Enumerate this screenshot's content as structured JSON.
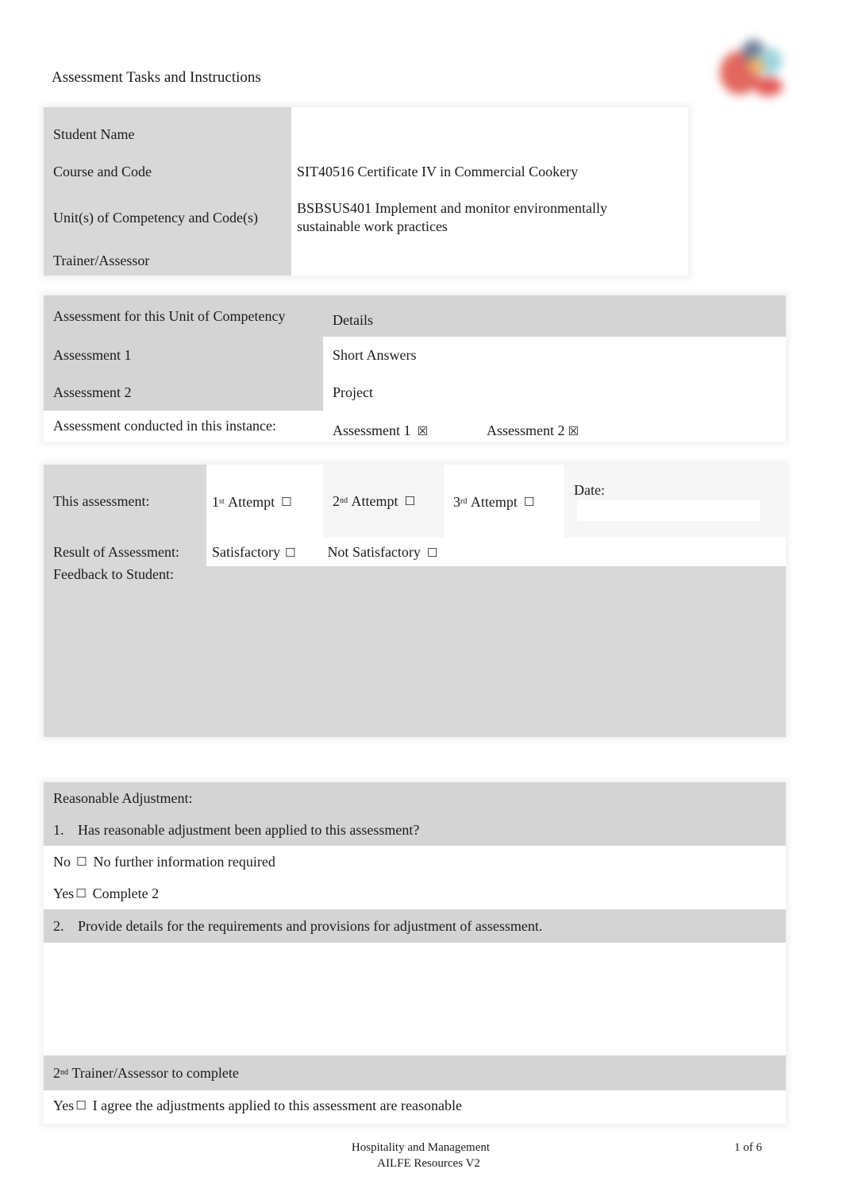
{
  "header": {
    "title": "Assessment Tasks and Instructions",
    "logo_icon": "institution-logo"
  },
  "student_info": {
    "rows": [
      {
        "label": "Student Name",
        "value": ""
      },
      {
        "label": "Course and Code",
        "value": "SIT40516 Certificate IV in Commercial Cookery"
      },
      {
        "label": "Unit(s) of Competency and Code(s)",
        "value_line1": "BSBSUS401 Implement and monitor environmentally",
        "value_line2": "sustainable work practices"
      },
      {
        "label": "Trainer/Assessor",
        "value": ""
      }
    ]
  },
  "assessments": {
    "header_col1": "Assessment for this Unit of Competency",
    "header_col2": "Details",
    "rows": [
      {
        "label": "Assessment 1",
        "detail": "Short Answers"
      },
      {
        "label": "Assessment 2",
        "detail": "Project"
      }
    ],
    "conducted_label": "Assessment conducted in this instance:",
    "conducted_options": [
      {
        "label": "Assessment 1",
        "checked": true,
        "glyph": "☒"
      },
      {
        "label": "Assessment 2",
        "checked": true,
        "glyph": "☒"
      }
    ]
  },
  "attempt": {
    "label": "This assessment:",
    "options": [
      {
        "num": "1",
        "sup": "st",
        "label": "Attempt",
        "checked": false,
        "glyph": "☐"
      },
      {
        "num": "2",
        "sup": "nd",
        "label": "Attempt",
        "checked": false,
        "glyph": "☐"
      },
      {
        "num": "3",
        "sup": "rd",
        "label": "Attempt",
        "checked": false,
        "glyph": "☐"
      }
    ],
    "date_label": "Date:",
    "date_value": ""
  },
  "result": {
    "label": "Result of Assessment:",
    "options": [
      {
        "label": "Satisfactory",
        "checked": false,
        "glyph": "☐"
      },
      {
        "label": "Not Satisfactory",
        "checked": false,
        "glyph": "☐"
      }
    ],
    "feedback_label": "Feedback to Student:",
    "feedback_value": ""
  },
  "reasonable_adjustment": {
    "heading": "Reasonable Adjustment:",
    "q1_num": "1.",
    "q1": "Has reasonable adjustment been applied to this assessment?",
    "no_label": "No",
    "no_glyph": "☐",
    "no_text": "No further information required",
    "yes_label": "Yes",
    "yes_glyph": "☐",
    "yes_text": "Complete 2",
    "q2_num": "2.",
    "q2": "Provide details for the requirements and provisions for adjustment of assessment.",
    "details_value": "",
    "second_assessor_num": "2",
    "second_assessor_sup": "nd",
    "second_assessor_text": "Trainer/Assessor to complete",
    "agree_label": "Yes",
    "agree_glyph": "☐",
    "agree_text": "I agree the adjustments applied to this assessment are reasonable"
  },
  "footer": {
    "line1": "Hospitality and Management",
    "line2": "AILFE Resources V2",
    "page": "1 of 6"
  }
}
